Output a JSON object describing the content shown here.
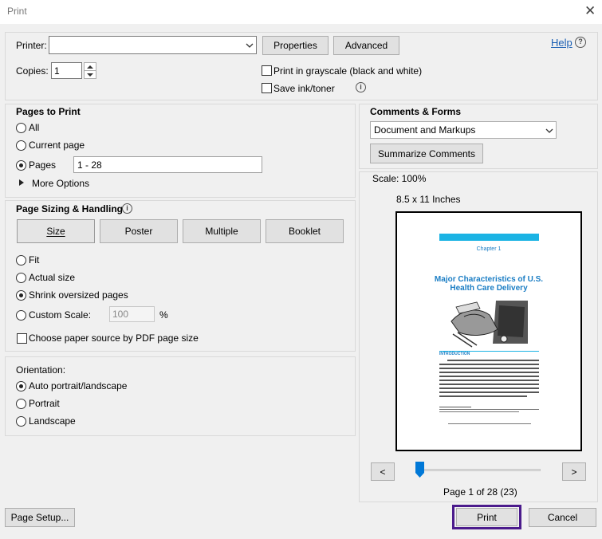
{
  "window": {
    "title": "Print"
  },
  "printer": {
    "label": "Printer:",
    "value": "",
    "properties_label": "Properties",
    "advanced_label": "Advanced",
    "help_label": "Help"
  },
  "copies": {
    "label": "Copies:",
    "value": "1"
  },
  "options": {
    "grayscale_label": "Print in grayscale (black and white)",
    "save_ink_label": "Save ink/toner"
  },
  "pages_to_print": {
    "heading": "Pages to Print",
    "all_label": "All",
    "current_label": "Current page",
    "pages_label": "Pages",
    "pages_value": "1 - 28",
    "more_options_label": "More Options"
  },
  "sizing": {
    "heading": "Page Sizing & Handling",
    "tabs": [
      "Size",
      "Poster",
      "Multiple",
      "Booklet"
    ],
    "fit_label": "Fit",
    "actual_label": "Actual size",
    "shrink_label": "Shrink oversized pages",
    "custom_label": "Custom Scale:",
    "custom_value": "100",
    "percent": "%",
    "paper_source_label": "Choose paper source by PDF page size"
  },
  "orientation": {
    "heading": "Orientation:",
    "auto_label": "Auto portrait/landscape",
    "portrait_label": "Portrait",
    "landscape_label": "Landscape"
  },
  "comments": {
    "heading": "Comments & Forms",
    "value": "Document and Markups",
    "summarize_label": "Summarize Comments"
  },
  "preview": {
    "scale": "Scale: 100%",
    "paper": "8.5 x 11 Inches",
    "chapter": "Chapter 1",
    "doc_title_1": "Major Characteristics of U.S.",
    "doc_title_2": "Health Care Delivery",
    "intro": "INTRODUCTION",
    "page_info": "Page 1 of 28 (23)",
    "prev": "<",
    "next": ">",
    "slider_position": 0.0
  },
  "footer": {
    "page_setup_label": "Page Setup...",
    "print_label": "Print",
    "cancel_label": "Cancel"
  },
  "colors": {
    "accent": "#0078d7",
    "print_border": "#4b1b8c",
    "chapter_bar": "#1bb3e4",
    "doc_title": "#1a7dc4"
  }
}
